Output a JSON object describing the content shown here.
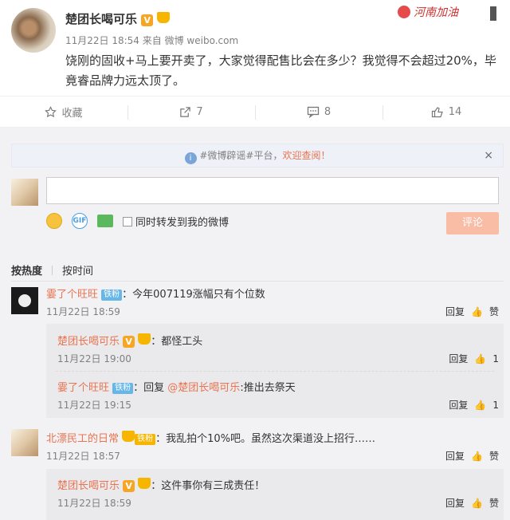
{
  "post": {
    "username": "楚团长喝可乐",
    "vip_badge": "V",
    "date": "11月22日 18:54",
    "from_prefix": "来自",
    "source": "微博 weibo.com",
    "content_line1": "饶刚的固收+马上要开卖了，大家觉得配售比会在多少？我觉得不会超过20%，毕",
    "content_line2": "竟睿品牌力远太顶了。",
    "banner_text": "河南加油"
  },
  "actions": {
    "favorite": "收藏",
    "repost_count": "7",
    "comment_count": "8",
    "like_count": "14"
  },
  "notice": {
    "prefix": "#微博辟谣#平台，",
    "highlight": "欢迎查阅！",
    "close": "×"
  },
  "composer": {
    "gif_label": "GIF",
    "checkbox_label": "同时转发到我的微博",
    "submit_label": "评论"
  },
  "sort": {
    "by_hot": "按热度",
    "by_time": "按时间"
  },
  "labels": {
    "reply": "回复",
    "like": "赞",
    "fan_iron": "铁粉"
  },
  "comments": [
    {
      "user": "霎了个旺旺",
      "text": "：今年007119涨幅只有个位数",
      "time": "11月22日 18:59",
      "replies": [
        {
          "user": "楚团长喝可乐",
          "text": "：都怪工头",
          "time": "11月22日 19:00",
          "likes": "1"
        },
        {
          "user": "霎了个旺旺",
          "text_prefix": "：回复 ",
          "mention": "@楚团长喝可乐",
          "text": ":推出去祭天",
          "time": "11月22日 19:15",
          "likes": "1"
        }
      ]
    },
    {
      "user": "北漂民工的日常",
      "text": "：我乱拍个10%吧。虽然这次渠道没上招行……",
      "time": "11月22日 18:57",
      "replies": [
        {
          "user": "楚团长喝可乐",
          "text": "：这件事你有三成责任！",
          "time": "11月22日 18:59"
        }
      ]
    }
  ],
  "colors": {
    "accent": "#eb7350",
    "badge": "#f6a623",
    "comment_bg": "#f2f2f5",
    "button": "#f9bca5"
  }
}
